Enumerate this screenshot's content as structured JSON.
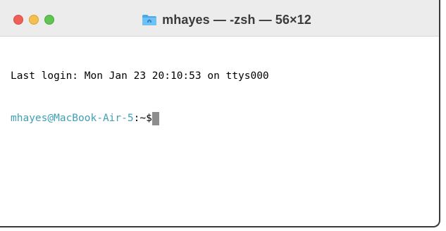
{
  "window": {
    "title": "mhayes — -zsh — 56×12",
    "icon": "folder-home-icon",
    "traffic_lights": {
      "close_color": "#ee5f57",
      "minimize_color": "#f5bf4f",
      "zoom_color": "#60c553"
    }
  },
  "terminal": {
    "last_login": "Last login: Mon Jan 23 20:10:53 on ttys000",
    "prompt_user_host": "mhayes@MacBook-Air-5",
    "prompt_path": ":~",
    "prompt_symbol": "$",
    "prompt_color": "#3f9fb5",
    "cursor_color": "#8e8e8e"
  }
}
